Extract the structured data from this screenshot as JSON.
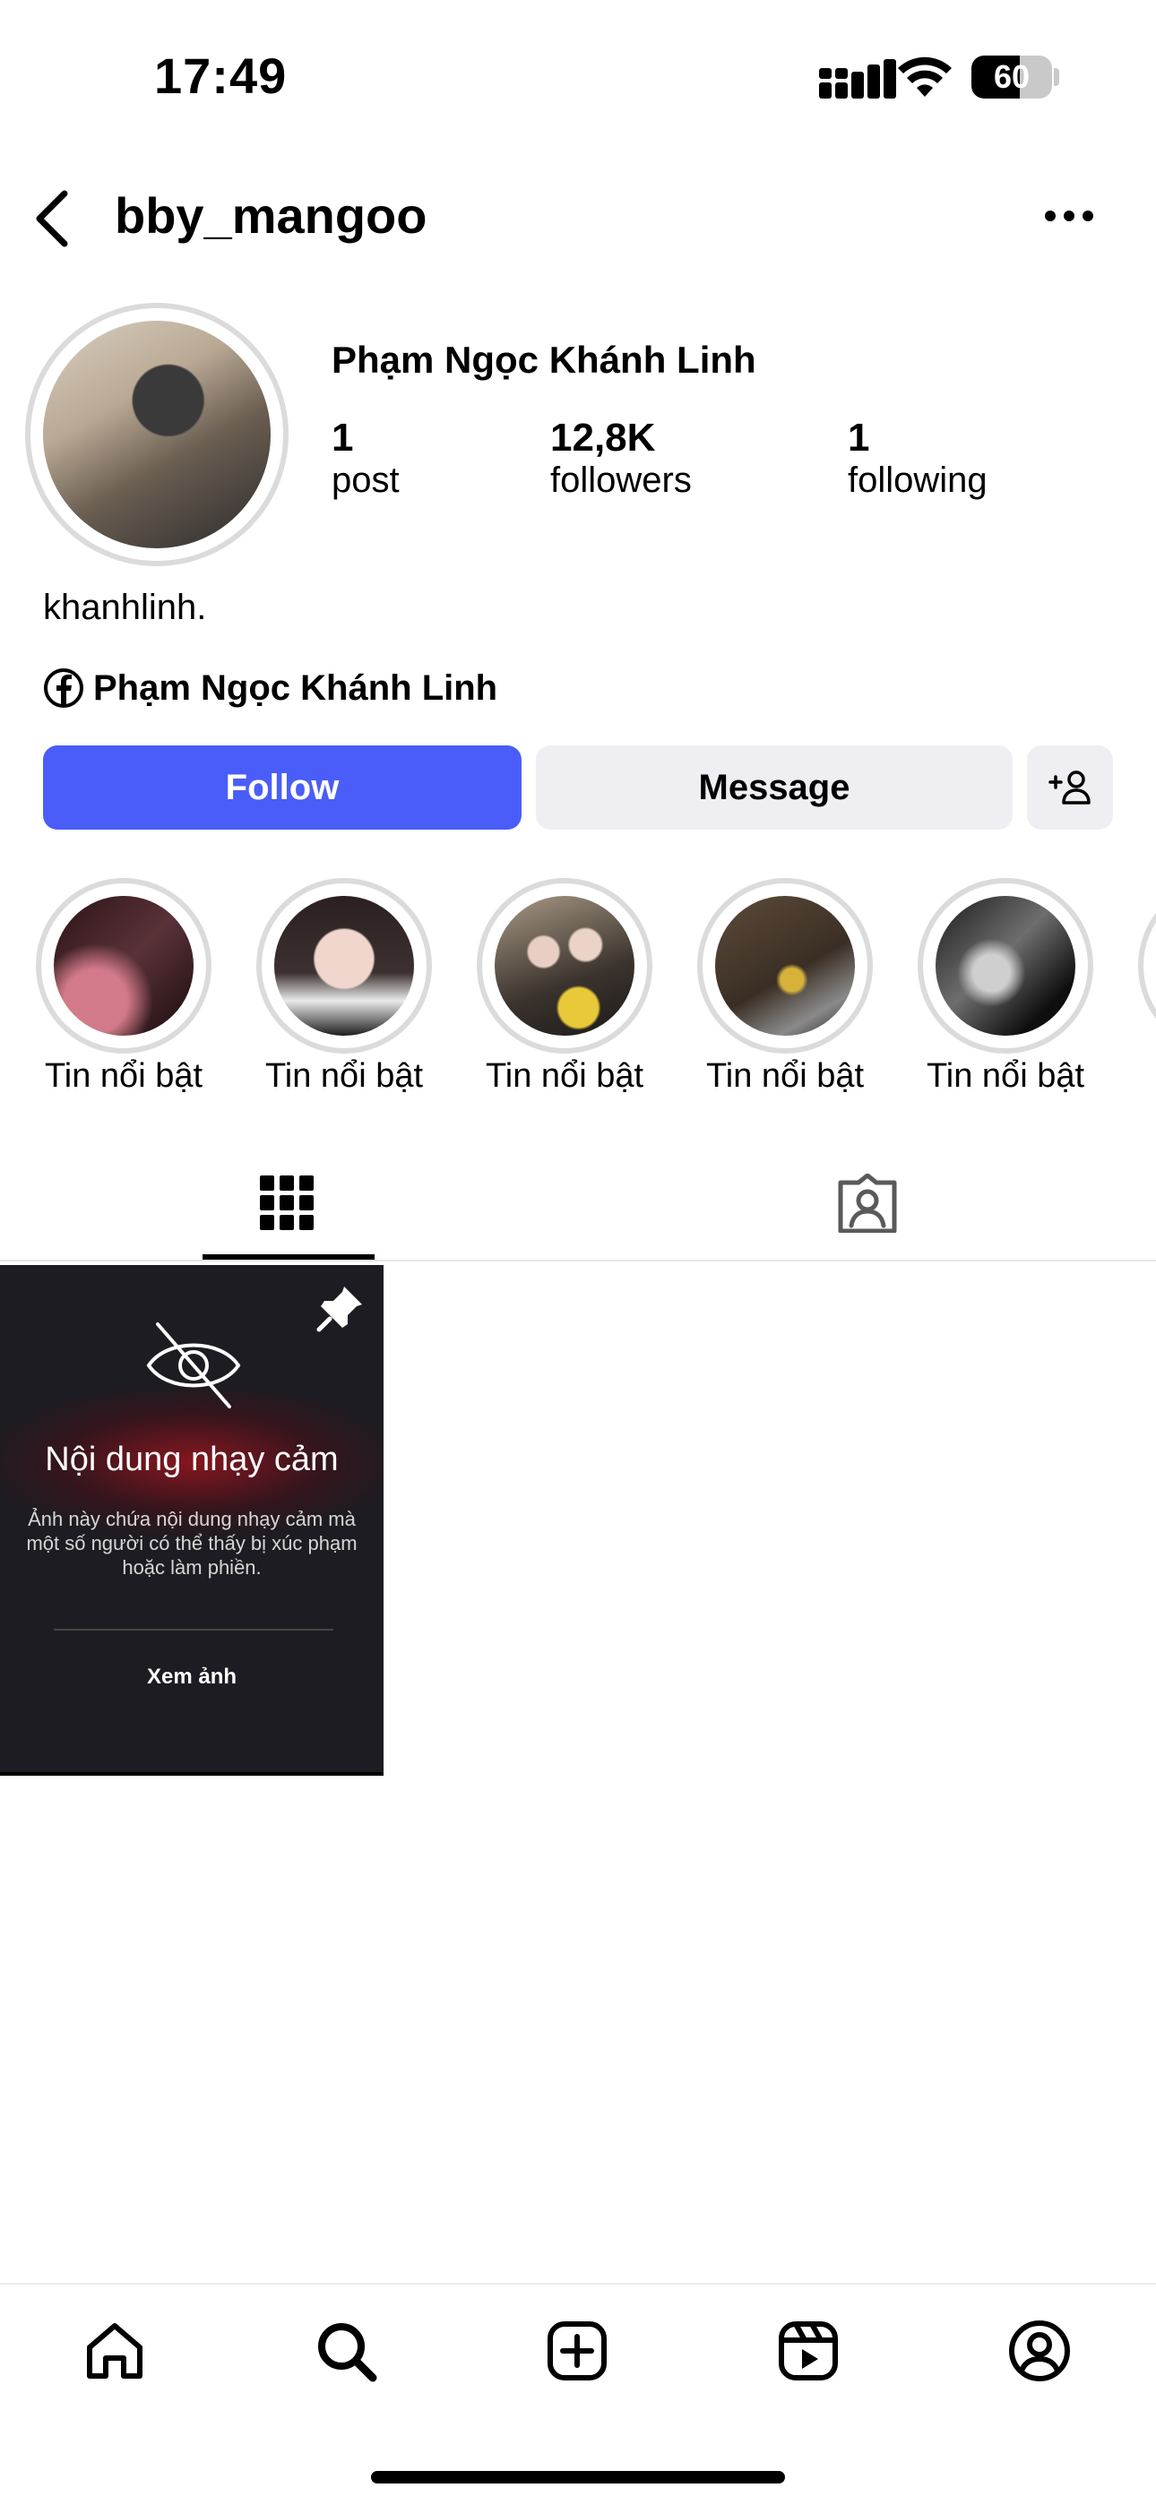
{
  "status_bar": {
    "time": "17:49",
    "battery": "60",
    "battery_level": 0.6
  },
  "header": {
    "username": "bby_mangoo",
    "back_icon": "chevron-left-icon",
    "more_icon": "more-horizontal-icon"
  },
  "profile": {
    "full_name": "Phạm Ngọc Khánh Linh",
    "stats": [
      {
        "value": "1",
        "label": "post"
      },
      {
        "value": "12,8K",
        "label": "followers"
      },
      {
        "value": "1",
        "label": "following"
      }
    ],
    "bio": "khanhlinh.",
    "facebook_name": "Phạm Ngọc Khánh Linh"
  },
  "actions": {
    "follow": "Follow",
    "message": "Message",
    "add_friend_icon": "person-add-icon"
  },
  "highlights": [
    {
      "label": "Tin nổi bật"
    },
    {
      "label": "Tin nổi bật"
    },
    {
      "label": "Tin nổi bật"
    },
    {
      "label": "Tin nổi bật"
    },
    {
      "label": "Tin nổi bật"
    }
  ],
  "tabs": [
    {
      "icon": "grid-icon",
      "active": true
    },
    {
      "icon": "tagged-icon",
      "active": false
    }
  ],
  "post": {
    "title": "Nội dung nhạy cảm",
    "description_lines": [
      "Ảnh này chứa nội dung nhạy cảm mà",
      "một số người có thể thấy bị xúc phạm",
      "hoặc làm phiền."
    ],
    "view_label": "Xem ảnh",
    "pinned": true
  },
  "bottom_nav": [
    "home-icon",
    "search-icon",
    "create-icon",
    "reels-icon",
    "profile-icon"
  ],
  "colors": {
    "follow_button": "#4a5df9",
    "secondary_button": "#efeff3"
  }
}
